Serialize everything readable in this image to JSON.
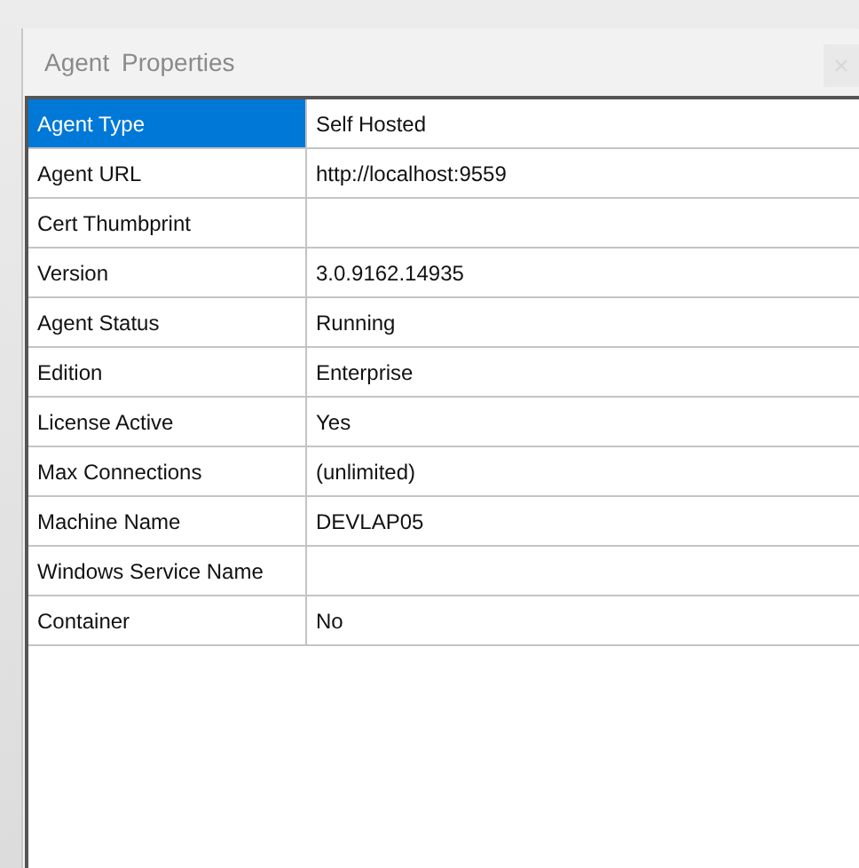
{
  "window": {
    "title": "Agent Properties"
  },
  "properties": [
    {
      "name": "Agent Type",
      "value": "Self Hosted",
      "selected": true
    },
    {
      "name": "Agent URL",
      "value": "http://localhost:9559",
      "selected": false
    },
    {
      "name": "Cert Thumbprint",
      "selected": false
    },
    {
      "name": "Version",
      "value": "3.0.9162.14935",
      "selected": false
    },
    {
      "name": "Agent Status",
      "value": "Running",
      "selected": false
    },
    {
      "name": "Edition",
      "value": "Enterprise",
      "selected": false
    },
    {
      "name": "License Active",
      "value": "Yes",
      "selected": false
    },
    {
      "name": "Max Connections",
      "value": "(unlimited)",
      "selected": false
    },
    {
      "name": "Machine Name",
      "value": "DEVLAP05",
      "selected": false
    },
    {
      "name": "Windows Service Name",
      "selected": false
    },
    {
      "name": "Container",
      "value": "No",
      "selected": false
    }
  ]
}
